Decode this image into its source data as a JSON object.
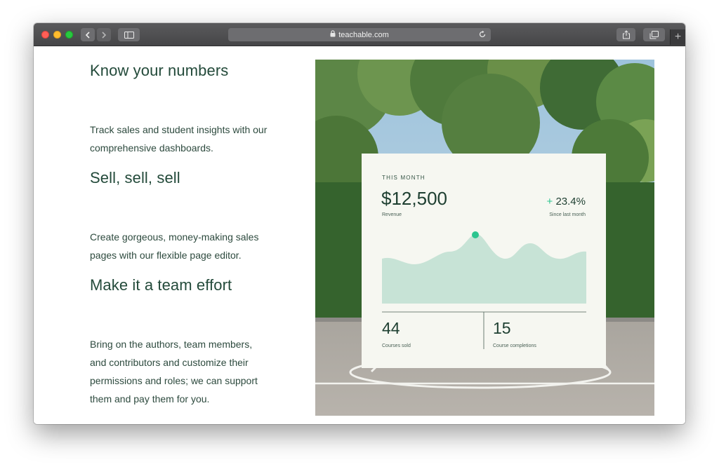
{
  "browser": {
    "url": "teachable.com"
  },
  "features": [
    {
      "title": "Know your numbers",
      "body": [
        "Track sales and student insights with our",
        "comprehensive dashboards."
      ]
    },
    {
      "title": "Sell, sell, sell",
      "body": [
        "Create gorgeous, money-making sales",
        "pages with our flexible page editor."
      ]
    },
    {
      "title": "Make it a team effort",
      "body": [
        "Bring on the authors, team members,",
        "and contributors and customize their",
        "permissions and roles; we can support",
        "them and pay them for you."
      ]
    }
  ],
  "dashboard": {
    "period_label": "THIS MONTH",
    "revenue": "$12,500",
    "revenue_label": "Revenue",
    "change_sign": "+",
    "change": "23.4%",
    "change_label": "Since last month",
    "courses_sold": "44",
    "courses_sold_label": "Courses sold",
    "course_completions": "15",
    "course_completions_label": "Course completions"
  },
  "colors": {
    "heading": "#234a3a",
    "accent": "#2cc58f",
    "area_fill": "#c7e3d6",
    "card_bg": "#f6f7f1"
  }
}
